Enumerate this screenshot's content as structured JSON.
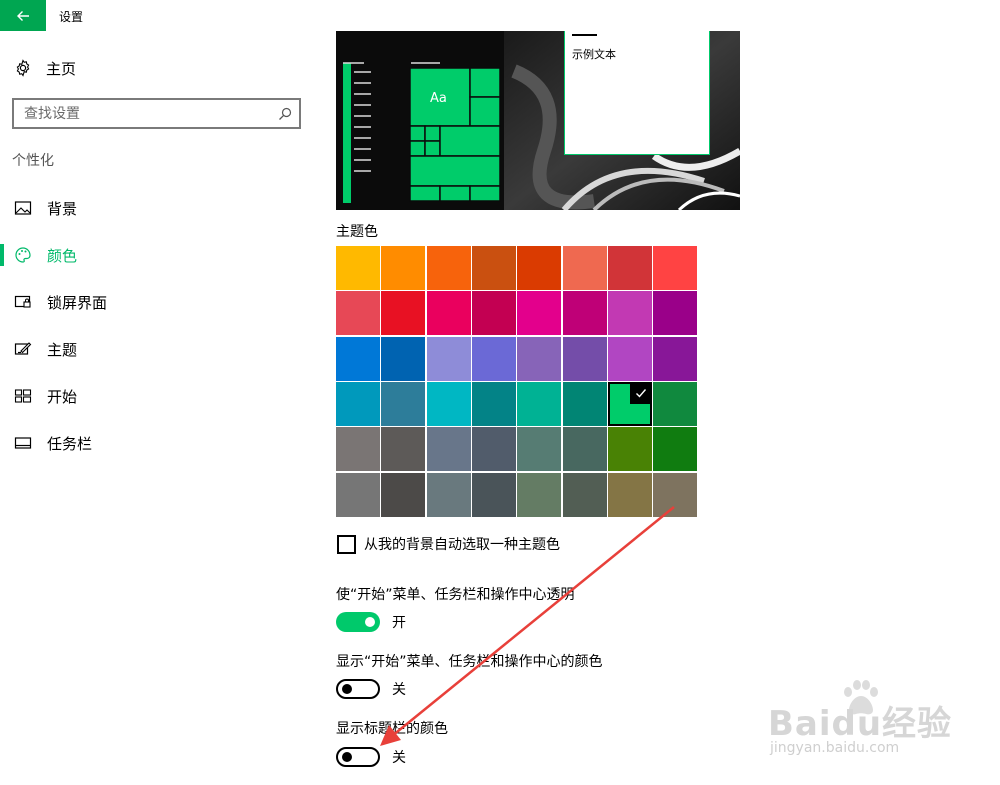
{
  "titlebar": {
    "title": "设置"
  },
  "sidebar": {
    "home_label": "主页",
    "search_placeholder": "查找设置",
    "section_heading": "个性化",
    "items": [
      {
        "label": "背景",
        "icon": "picture-icon",
        "active": false
      },
      {
        "label": "颜色",
        "icon": "palette-icon",
        "active": true
      },
      {
        "label": "锁屏界面",
        "icon": "lock-screen-icon",
        "active": false
      },
      {
        "label": "主题",
        "icon": "theme-brush-icon",
        "active": false
      },
      {
        "label": "开始",
        "icon": "start-grid-icon",
        "active": false
      },
      {
        "label": "任务栏",
        "icon": "taskbar-icon",
        "active": false
      }
    ]
  },
  "preview": {
    "sample_text": "示例文本",
    "tile_text": "Aa"
  },
  "theme_color": {
    "heading": "主题色",
    "selected_index": 30,
    "swatches": [
      "#FFB900",
      "#FF8C00",
      "#F7630C",
      "#CA5010",
      "#DA3B01",
      "#EF6950",
      "#D13438",
      "#FF4343",
      "#E74856",
      "#E81123",
      "#EA005E",
      "#C30052",
      "#E3008C",
      "#BF0077",
      "#C239B3",
      "#9A0089",
      "#0078D7",
      "#0063B1",
      "#8E8CD8",
      "#6B69D6",
      "#8764B8",
      "#744DA9",
      "#B146C2",
      "#881798",
      "#0099BC",
      "#2D7D9A",
      "#00B7C3",
      "#038387",
      "#00B294",
      "#018574",
      "#00CC6A",
      "#10893E",
      "#7A7574",
      "#5D5A58",
      "#68768A",
      "#515C6B",
      "#567C73",
      "#486860",
      "#498205",
      "#107C10",
      "#767676",
      "#4C4A48",
      "#69797E",
      "#4A5459",
      "#647C64",
      "#525E54",
      "#847545",
      "#7E735F"
    ]
  },
  "auto_pick": {
    "label": "从我的背景自动选取一种主题色",
    "checked": false
  },
  "settings": [
    {
      "label": "使“开始”菜单、任务栏和操作中心透明",
      "state_label": "开",
      "on": true
    },
    {
      "label": "显示“开始”菜单、任务栏和操作中心的颜色",
      "state_label": "关",
      "on": false
    },
    {
      "label": "显示标题栏的颜色",
      "state_label": "关",
      "on": false
    }
  ],
  "colors": {
    "accent": "#00CC6A",
    "back_button": "#00A651",
    "annotation_arrow": "#E8403A"
  },
  "watermark": {
    "brand": "Baidu经验",
    "url": "jingyan.baidu.com"
  }
}
